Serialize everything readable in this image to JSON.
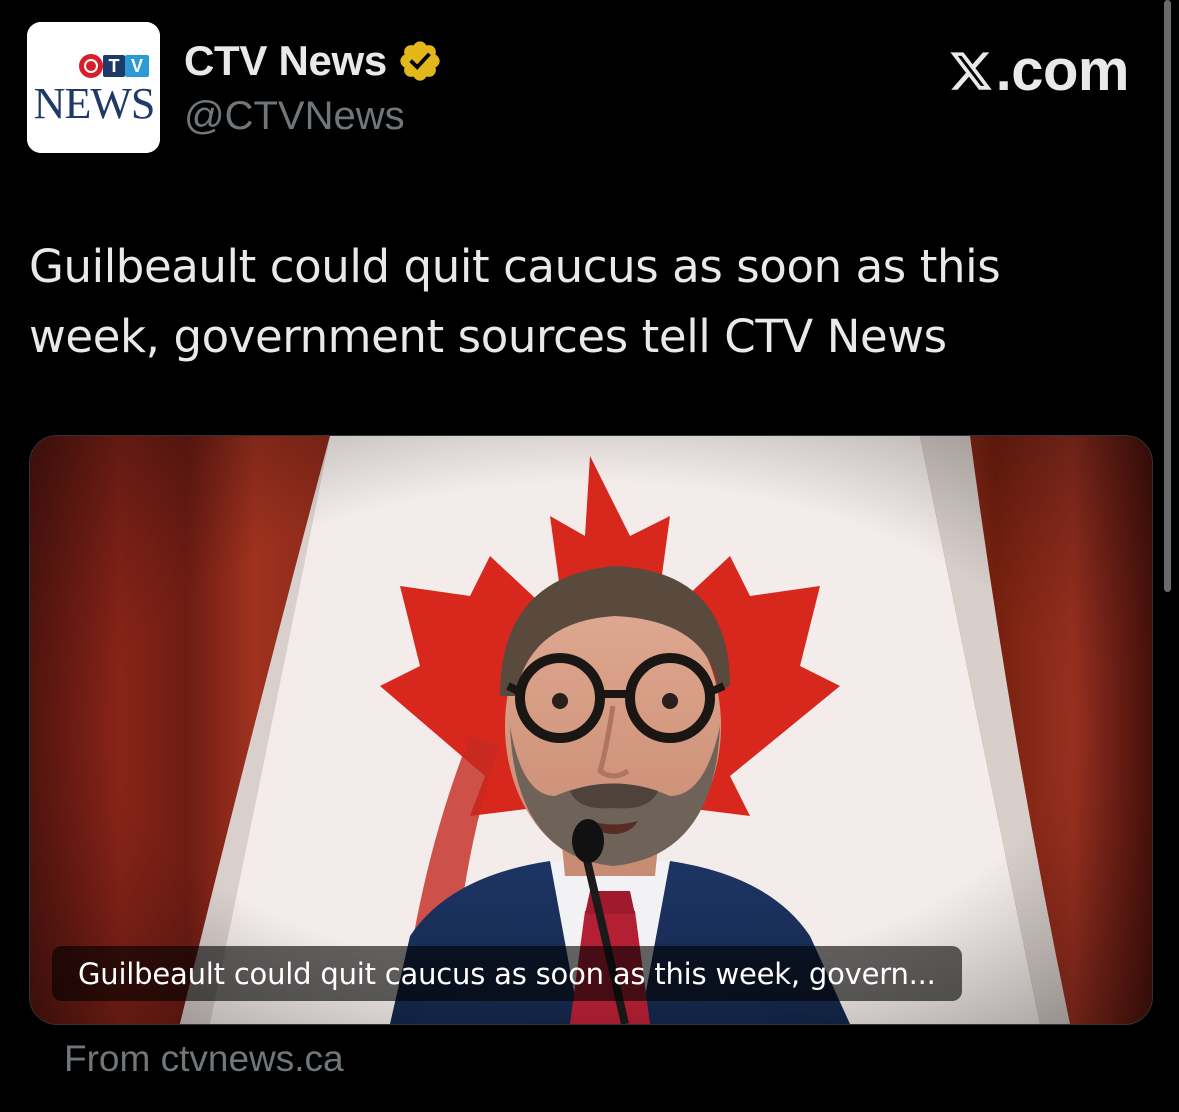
{
  "account": {
    "display_name": "CTV News",
    "handle": "@CTVNews",
    "verified_icon": "gold-checkmark-badge",
    "avatar_logo_ctv": "CTV",
    "avatar_logo_news": "NEWS"
  },
  "watermark": {
    "logo_icon": "x-logo",
    "site_label": ".com"
  },
  "tweet": {
    "text": "Guilbeault could quit caucus as soon as this week, government sources tell CTV News"
  },
  "link_card": {
    "caption": "Guilbeault could quit caucus as soon as this week, govern...",
    "source": "From ctvnews.ca"
  },
  "colors": {
    "background": "#000000",
    "text_primary": "#e7e9ea",
    "text_secondary": "#71767b",
    "verified_gold": "#e2b719",
    "ctv_red": "#d81e2b",
    "news_navy": "#1f3a68"
  }
}
